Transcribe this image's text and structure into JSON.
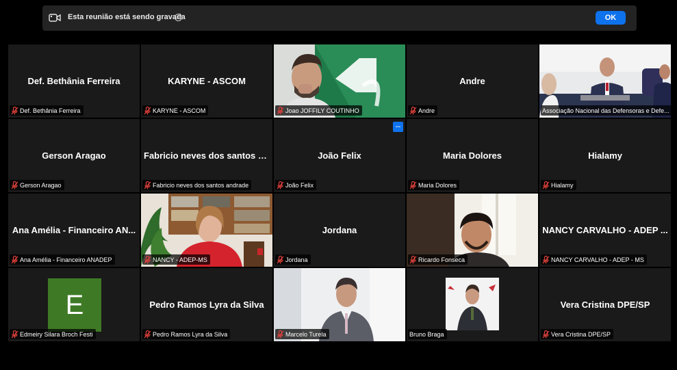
{
  "banner": {
    "message": "Esta reunião está sendo gravada",
    "info_glyph": "i",
    "ok_label": "OK",
    "icon": "camera-record-icon"
  },
  "more_button": "...",
  "accent_color": "#0e72ed",
  "muted_icon_color": "#e0413a",
  "tiles": [
    {
      "name": "Def. Bethânia Ferreira",
      "tag": "Def. Bethânia Ferreira"
    },
    {
      "name": "KARYNE - ASCOM",
      "tag": "KARYNE - ASCOM"
    },
    {
      "name": "",
      "tag": "Joao JOFFILY COUTINHO"
    },
    {
      "name": "Andre",
      "tag": "Andre"
    },
    {
      "name": "",
      "tag": "Associação Nacional das Defensoras e Defe..."
    },
    {
      "name": "Gerson Aragao",
      "tag": "Gerson Aragao"
    },
    {
      "name": "Fabricio neves dos santos an...",
      "tag": "Fabricio neves dos santos andrade"
    },
    {
      "name": "João Felix",
      "tag": "João Felix"
    },
    {
      "name": "Maria Dolores",
      "tag": "Maria Dolores"
    },
    {
      "name": "Hialamy",
      "tag": "Hialamy"
    },
    {
      "name": "Ana Amélia - Financeiro AN...",
      "tag": "Ana Amélia - Financeiro ANADEP"
    },
    {
      "name": "",
      "tag": "NANCY - ADEP-MS"
    },
    {
      "name": "Jordana",
      "tag": "Jordana"
    },
    {
      "name": "",
      "tag": "Ricardo Fonseca"
    },
    {
      "name": "NANCY CARVALHO - ADEP ...",
      "tag": "NANCY CARVALHO - ADEP - MS"
    },
    {
      "name": "",
      "avatar_letter": "E",
      "tag": "Edmeiry Silara Broch Festi"
    },
    {
      "name": "Pedro Ramos Lyra da Silva",
      "tag": "Pedro Ramos Lyra da Silva"
    },
    {
      "name": "",
      "tag": "Marcelo Turela"
    },
    {
      "name": "",
      "tag": "Bruno Braga"
    },
    {
      "name": "Vera Cristina DPE/SP",
      "tag": "Vera Cristina DPE/SP"
    }
  ]
}
